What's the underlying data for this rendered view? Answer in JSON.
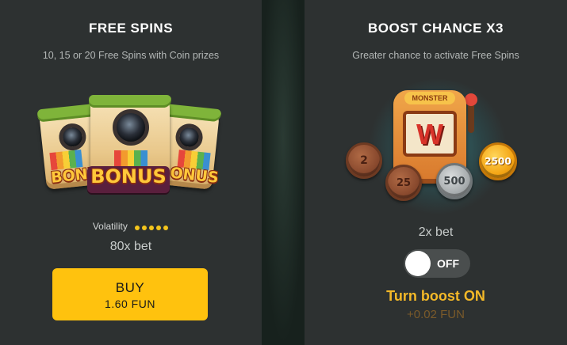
{
  "free_spins": {
    "title": "FREE SPINS",
    "subtitle": "10, 15 or 20 Free Spins with Coin prizes",
    "art_text": "BONUS",
    "volatility_label": "Volatility",
    "volatility_level": 5,
    "volatility_max": 5,
    "bet_multiplier": "80x bet",
    "buy_label": "BUY",
    "buy_price": "1.60 FUN"
  },
  "boost_chance": {
    "title": "BOOST CHANCE X3",
    "subtitle": "Greater chance to activate Free Spins",
    "machine_sign": "MONSTER",
    "machine_symbol": "W",
    "coins": [
      "2",
      "25",
      "500",
      "2500"
    ],
    "bet_multiplier": "2x bet",
    "toggle_state": "OFF",
    "cta": "Turn boost ON",
    "cost": "+0.02 FUN"
  },
  "colors": {
    "panel_bg": "#2d3131",
    "accent_yellow": "#ffc20e",
    "boost_text": "#f4b928",
    "volatility_dot": "#f4c51c"
  }
}
